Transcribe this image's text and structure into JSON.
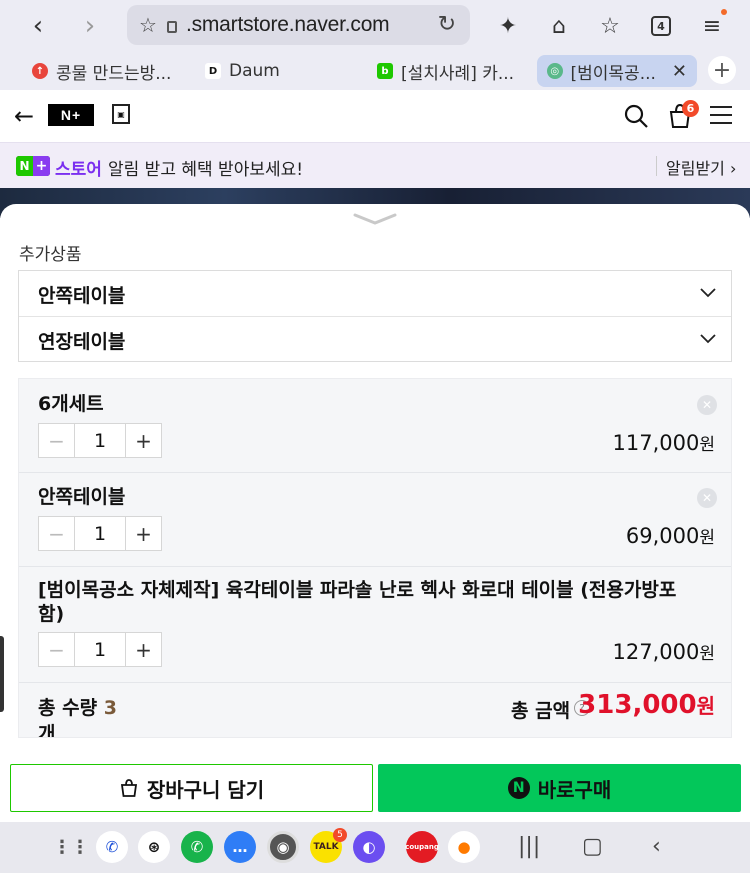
{
  "browser": {
    "url": ".smartstore.naver.com",
    "tab_count": "4",
    "tabs": [
      {
        "label": "콩물 만드는방...",
        "favicon_color": "#e8453c"
      },
      {
        "label": "Daum",
        "favicon_color": "#222222"
      },
      {
        "label": "[설치사례] 카...",
        "favicon_color": "#1ec800"
      },
      {
        "label": "[범이목공...",
        "favicon_color": "#5ab88a"
      }
    ]
  },
  "header": {
    "logo": "N+",
    "cart_badge": "6"
  },
  "notice": {
    "brand_n": "N",
    "brand_plus": "+",
    "store_label": "스토어",
    "message": "알림 받고 혜택 받아보세요!",
    "action_label": "알림받기 ›"
  },
  "sheet": {
    "addon_section_label": "추가상품",
    "addons": [
      {
        "label": "안쪽테이블"
      },
      {
        "label": "연장테이블"
      }
    ],
    "items": [
      {
        "name": "6개세트",
        "qty": "1",
        "price": "117,000",
        "currency": "원"
      },
      {
        "name": "안쪽테이블",
        "qty": "1",
        "price": "69,000",
        "currency": "원"
      },
      {
        "name": "[범이목공소 자체제작] 육각테이블 파라솔 난로 헥사 화로대 테이블 (전용가방포함)",
        "qty": "1",
        "price": "127,000",
        "currency": "원"
      }
    ],
    "total_qty_label": "총 수량",
    "total_qty_value": "3",
    "total_qty_unit": "개",
    "total_amount_label": "총 금액",
    "total_amount": "313,000",
    "total_currency": "원"
  },
  "actions": {
    "cart_label": "장바구니 담기",
    "buy_icon": "N",
    "buy_label": "바로구매"
  },
  "dock": {
    "kakao_badge": "5",
    "kakao_label": "TALK",
    "coupang_label": "coupang"
  },
  "colors": {
    "naver_green": "#03c75a",
    "price_red": "#e0112b",
    "store_purple": "#7b2ff0"
  }
}
